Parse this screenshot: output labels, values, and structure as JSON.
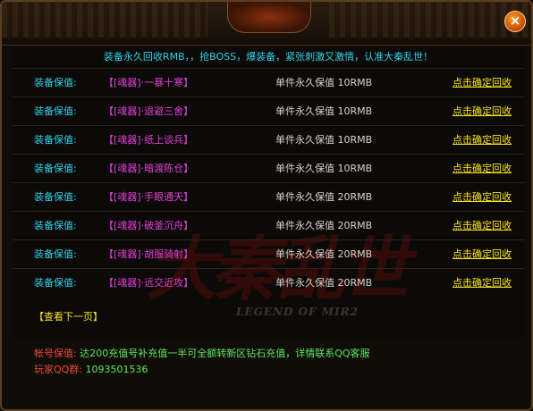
{
  "headline": "装备永久回收RMB，，抢BOSS，爆装备，紧张刺激又激情，认准大秦乱世！",
  "rows": [
    {
      "label": "装备保值:",
      "item": "【[魂器]·一暴十寒】",
      "price": "单件永久保值 10RMB",
      "action": "点击确定回收"
    },
    {
      "label": "装备保值:",
      "item": "【[魂器]·退避三舍】",
      "price": "单件永久保值 10RMB",
      "action": "点击确定回收"
    },
    {
      "label": "装备保值:",
      "item": "【[魂器]·纸上谈兵】",
      "price": "单件永久保值 10RMB",
      "action": "点击确定回收"
    },
    {
      "label": "装备保值:",
      "item": "【[魂器]·暗渡陈仓】",
      "price": "单件永久保值 10RMB",
      "action": "点击确定回收"
    },
    {
      "label": "装备保值:",
      "item": "【[魂器]·手眼通天】",
      "price": "单件永久保值 20RMB",
      "action": "点击确定回收"
    },
    {
      "label": "装备保值:",
      "item": "【[魂器]·破釜沉舟】",
      "price": "单件永久保值 20RMB",
      "action": "点击确定回收"
    },
    {
      "label": "装备保值:",
      "item": "【[魂器]·胡服骑射】",
      "price": "单件永久保值 20RMB",
      "action": "点击确定回收"
    },
    {
      "label": "装备保值:",
      "item": "【[魂器]·远交近攻】",
      "price": "单件永久保值 20RMB",
      "action": "点击确定回收"
    }
  ],
  "next_page": "【查看下一页】",
  "footer": {
    "account_label": "帐号保值:",
    "account_text": "达200充值号补充值一半可全额转新区钻石充值，详情联系QQ客服",
    "qq_label": "玩家QQ群:",
    "qq_value": "1093501536"
  },
  "watermark": {
    "logo": "大秦乱世",
    "sub": "LEGEND OF MIR2"
  },
  "icons": {
    "close": "close-icon"
  },
  "colors": {
    "cyan": "#30d0e8",
    "magenta": "#e040d8",
    "yellow": "#f8e41a",
    "red": "#e84a3c",
    "green": "#5be860"
  }
}
